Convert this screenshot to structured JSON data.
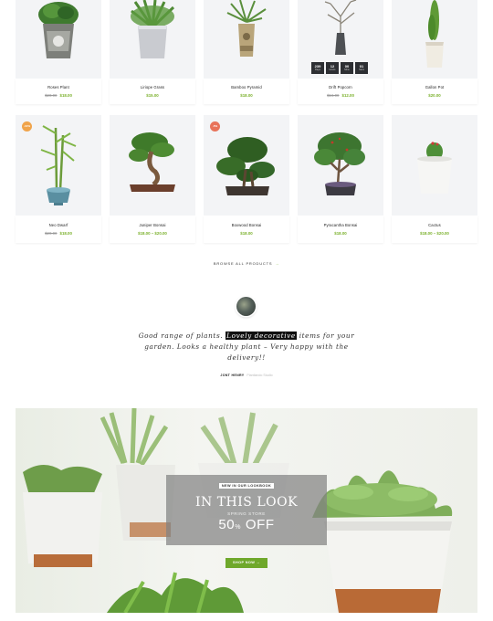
{
  "products_row1": [
    {
      "name": "Roses Plant",
      "old_price": "$20.00",
      "price": "$18.00"
    },
    {
      "name": "Liriope Grass",
      "old_price": "",
      "price": "$15.00"
    },
    {
      "name": "Bamboo Pyramid",
      "old_price": "",
      "price": "$18.00"
    },
    {
      "name": "Drift Popcorn",
      "old_price": "$16.00",
      "price": "$12.00"
    },
    {
      "name": "Gallon Pot",
      "old_price": "",
      "price": "$20.00"
    }
  ],
  "countdown": [
    {
      "value": "239",
      "unit": "Days"
    },
    {
      "value": "12",
      "unit": "Hours"
    },
    {
      "value": "00",
      "unit": "Mins"
    },
    {
      "value": "01",
      "unit": "Secs"
    }
  ],
  "products_row2": [
    {
      "name": "Neo Dwarf",
      "old_price": "$20.00",
      "price": "$18.00",
      "badge": "-10%"
    },
    {
      "name": "Juniper Bonsai",
      "old_price": "",
      "price": "$18.00 – $20.00",
      "badge": ""
    },
    {
      "name": "Boxwood Bonsai",
      "old_price": "",
      "price": "$18.00",
      "badge": "-5%"
    },
    {
      "name": "Pyracantha Bonsai",
      "old_price": "",
      "price": "$18.00",
      "badge": ""
    },
    {
      "name": "Cactus",
      "old_price": "",
      "price": "$18.00 – $20.00",
      "badge": ""
    }
  ],
  "browse": {
    "label": "BROWSE ALL PRODUCTS",
    "arrow": "→"
  },
  "testimonial": {
    "text_before": "Good range of plants. ",
    "highlight": "Lovely decorative",
    "text_after": " items for your garden. Looks a healthy plant – Very happy with the delivery!!",
    "author": "JONT HENRY",
    "role": "Plantlando Studio"
  },
  "banner": {
    "tag": "NEW IN OUR LOOKBOOK",
    "title": "IN THIS LOOK",
    "subtitle": "SPRING STORE",
    "offer_number": "50",
    "offer_percent": "%",
    "offer_text": "OFF",
    "button": "SHOP NOW →"
  },
  "colors": {
    "accent": "#7ab02b",
    "badge_orange": "#f0a44b",
    "badge_red": "#e8735a",
    "dark": "#2d2f33"
  }
}
